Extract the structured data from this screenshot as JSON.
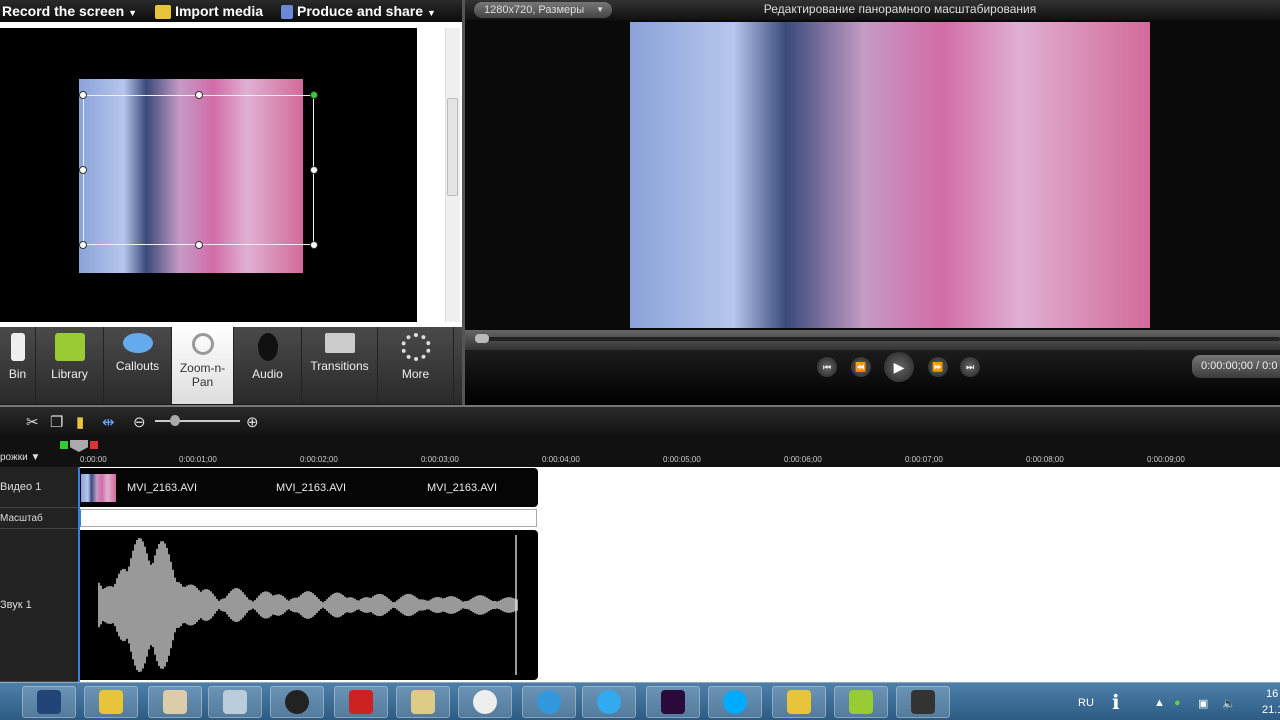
{
  "toolbar": {
    "record": "Record the screen",
    "import": "Import media",
    "produce": "Produce and share"
  },
  "tabs": [
    {
      "label": "Bin"
    },
    {
      "label": "Library"
    },
    {
      "label": "Callouts"
    },
    {
      "label": "Zoom-n-Pan",
      "active": true
    },
    {
      "label": "Audio"
    },
    {
      "label": "Transitions"
    },
    {
      "label": "More"
    }
  ],
  "preview": {
    "size_dropdown": "1280x720, Размеры",
    "title": "Редактирование панорамного масштабирования",
    "time": "0:00:00;00 / 0:0",
    "progress": 0
  },
  "timeline": {
    "tracks_menu": "рожки",
    "ruler": [
      "0:00:00",
      "0:00:01;00",
      "0:00:02;00",
      "0:00:03;00",
      "0:00:04;00",
      "0:00:05;00",
      "0:00:06;00",
      "0:00:07;00",
      "0:00:08;00",
      "0:00:09;00"
    ],
    "video_track": "Видео 1",
    "zoom_track": "Масштаб",
    "audio_track": "Звук 1",
    "clip_name": "MVI_2163.AVI"
  },
  "taskbar": {
    "lang": "RU",
    "clock_time": "16",
    "clock_date": "21.1"
  },
  "colors": {
    "accent": "#3a7be0",
    "taskbar": "#3d6f98"
  }
}
